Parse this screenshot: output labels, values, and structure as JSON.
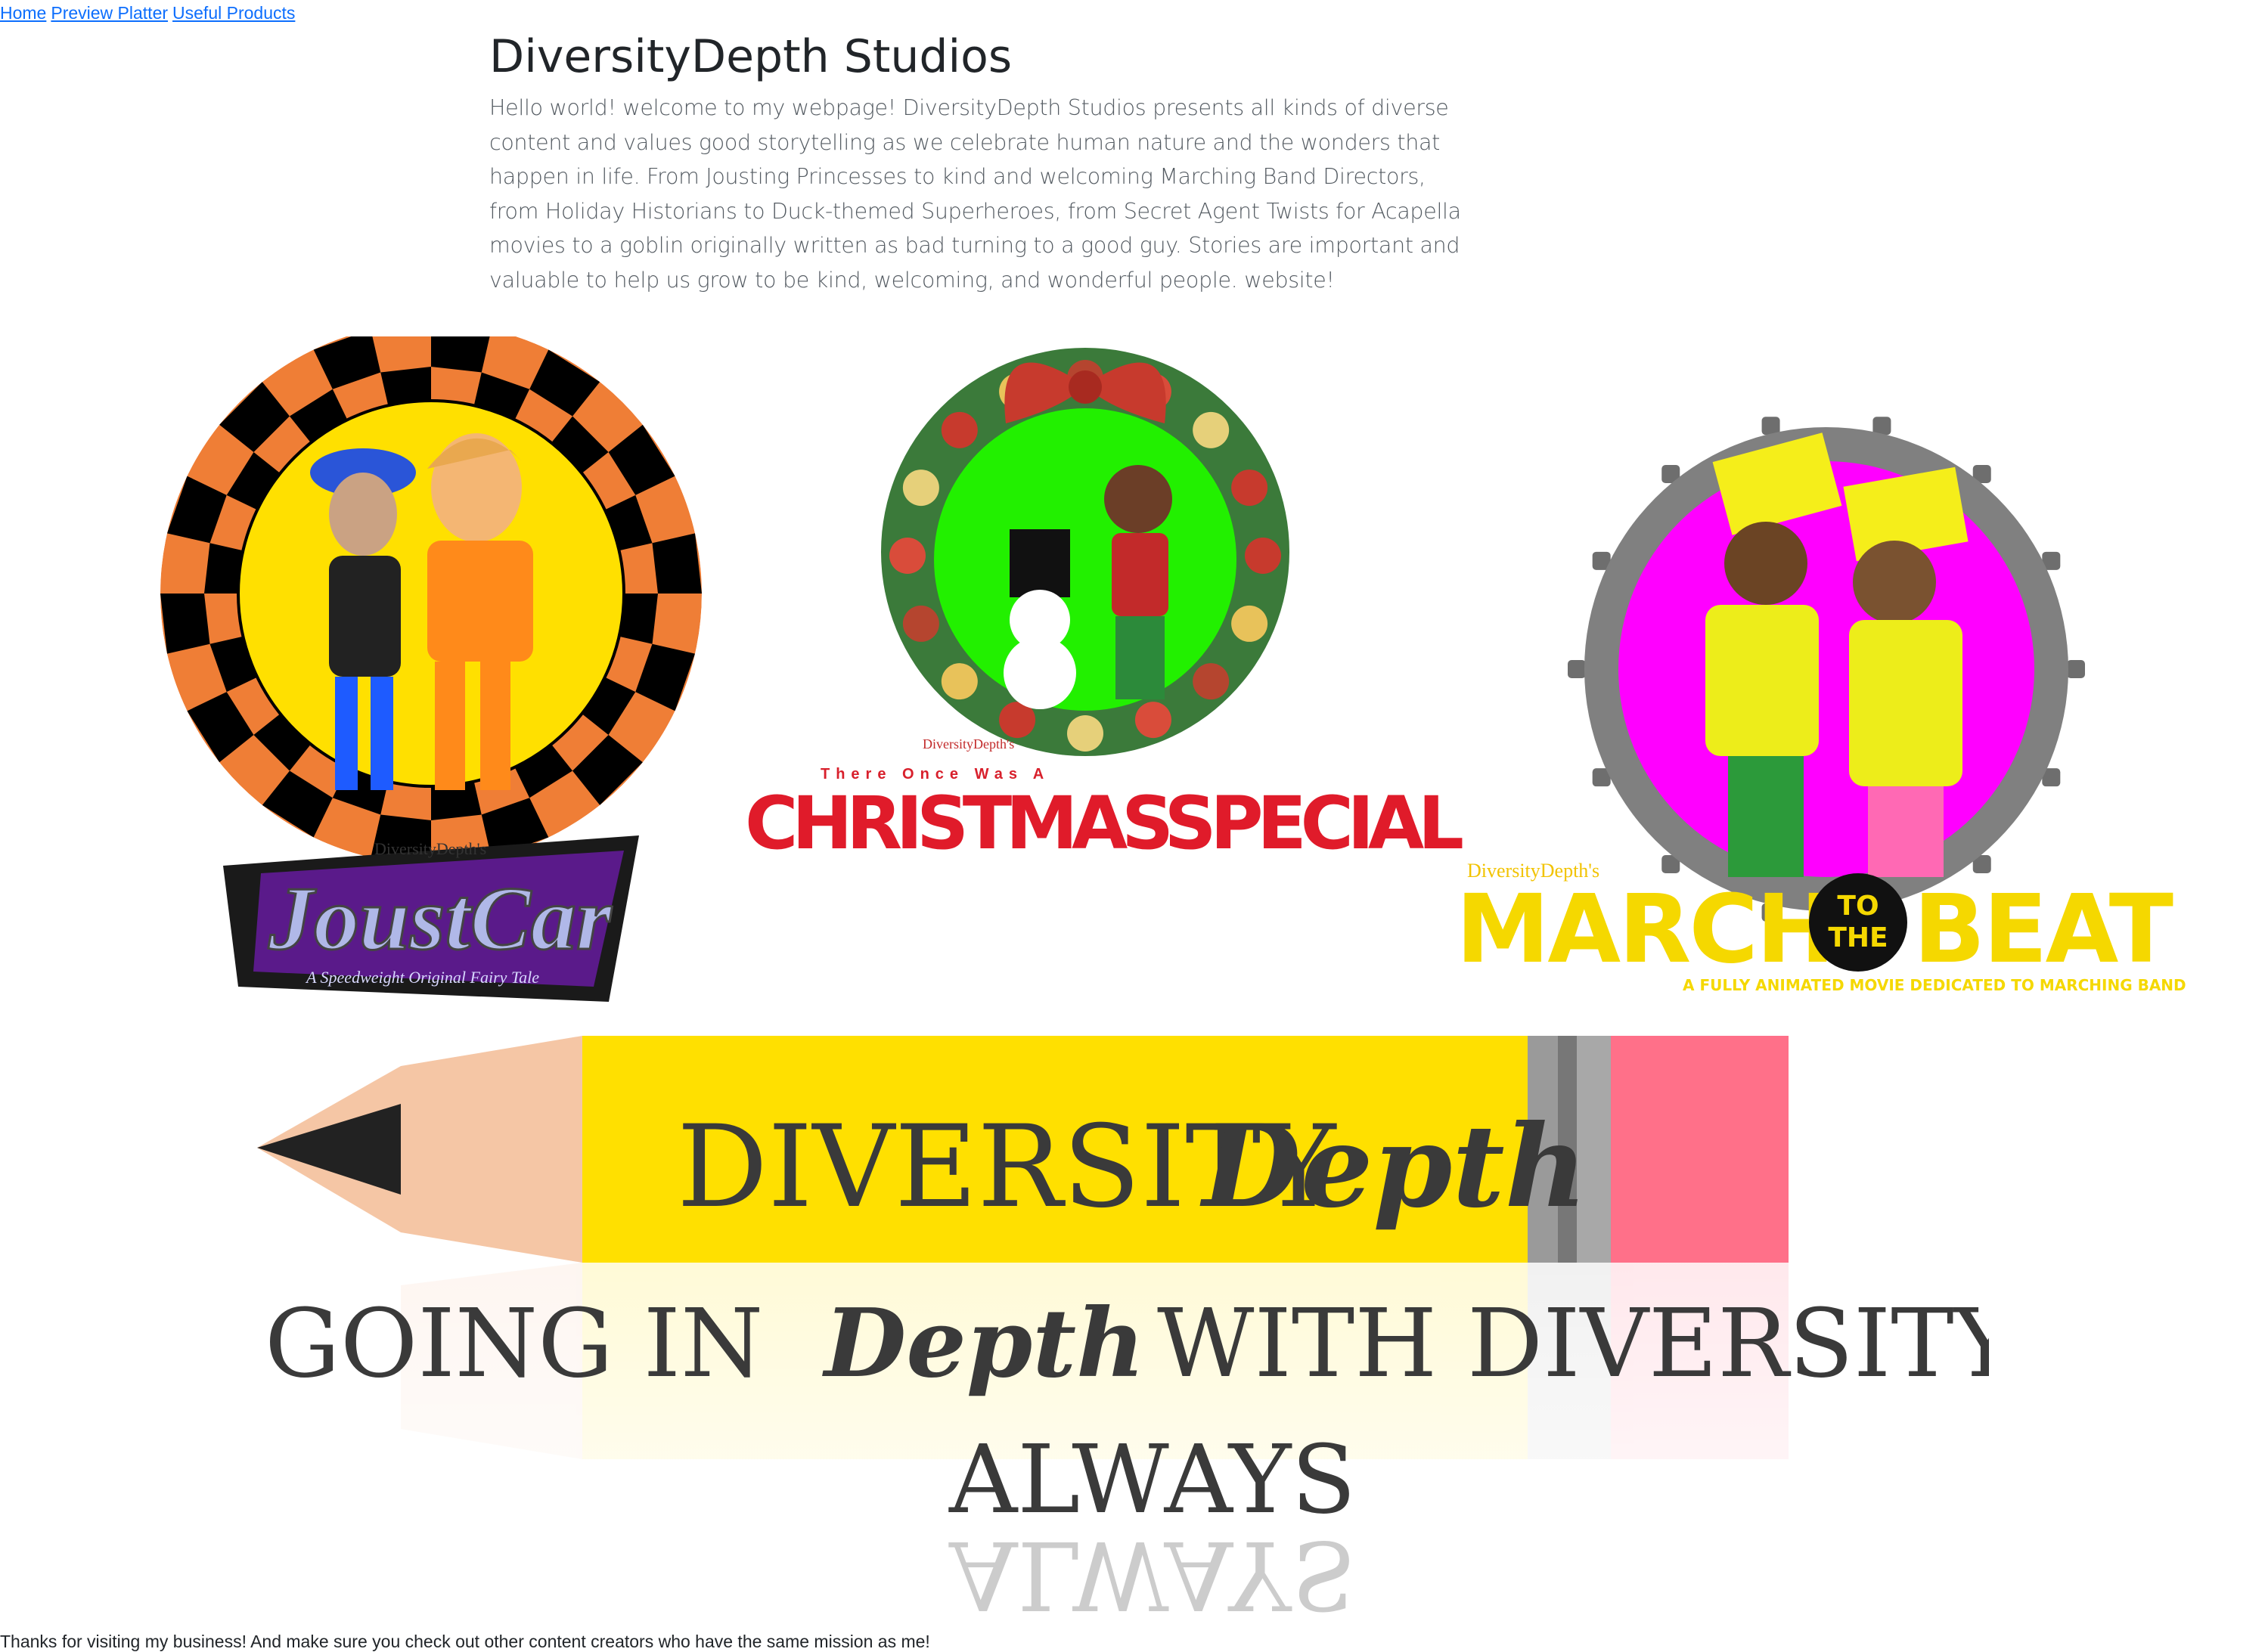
{
  "nav": {
    "home": "Home",
    "preview": "Preview Platter",
    "products": "Useful Products"
  },
  "header": {
    "title": "DiversityDepth Studios",
    "intro": "Hello world! welcome to my webpage! DiversityDepth Studios presents all kinds of diverse content and values good storytelling as we celebrate human nature and the wonders that happen in life. From Jousting Princesses to kind and welcoming Marching Band Directors, from Holiday Historians to Duck-themed Superheroes, from Secret Agent Twists for Acapella movies to a goblin originally written as bad turning to a good guy. Stories are important and valuable to help us grow to be kind, welcoming, and wonderful people. website!"
  },
  "logos": {
    "joustcar": {
      "brand": "DiversityDepth's",
      "title": "JoustCar",
      "tagline": "A Speedweight Original Fairy Tale"
    },
    "christmas": {
      "brand": "DiversityDepth's",
      "subtitle": "There Once Was A",
      "title": "CHRISTMASSPECIAL"
    },
    "march": {
      "brand": "DiversityDepth's",
      "word1": "MARCH",
      "to": "TO",
      "the": "THE",
      "word2": "BEAT",
      "tagline": "A FULLY ANIMATED MOVIE DEDICATED TO MARCHING BAND"
    },
    "pencil": {
      "brand_a": "DIVERSITY",
      "brand_b": "Depth",
      "slogan_a": "GOING IN",
      "slogan_b": "Depth",
      "slogan_c": "WITH DIVERSITY",
      "slogan_d": "ALWAYS"
    }
  },
  "colors": {
    "link": "#0d6efd",
    "orange": "#ef7e36",
    "yellow": "#ffe000",
    "magenta": "#ff00ff",
    "pink": "#ff7089",
    "christmas_red": "#e01b2a",
    "wreath_green": "#3b7a3a",
    "bright_green": "#22f000"
  },
  "footer": {
    "text": "Thanks for visiting my business! And make sure you check out other content creators who have the same mission as me!"
  }
}
